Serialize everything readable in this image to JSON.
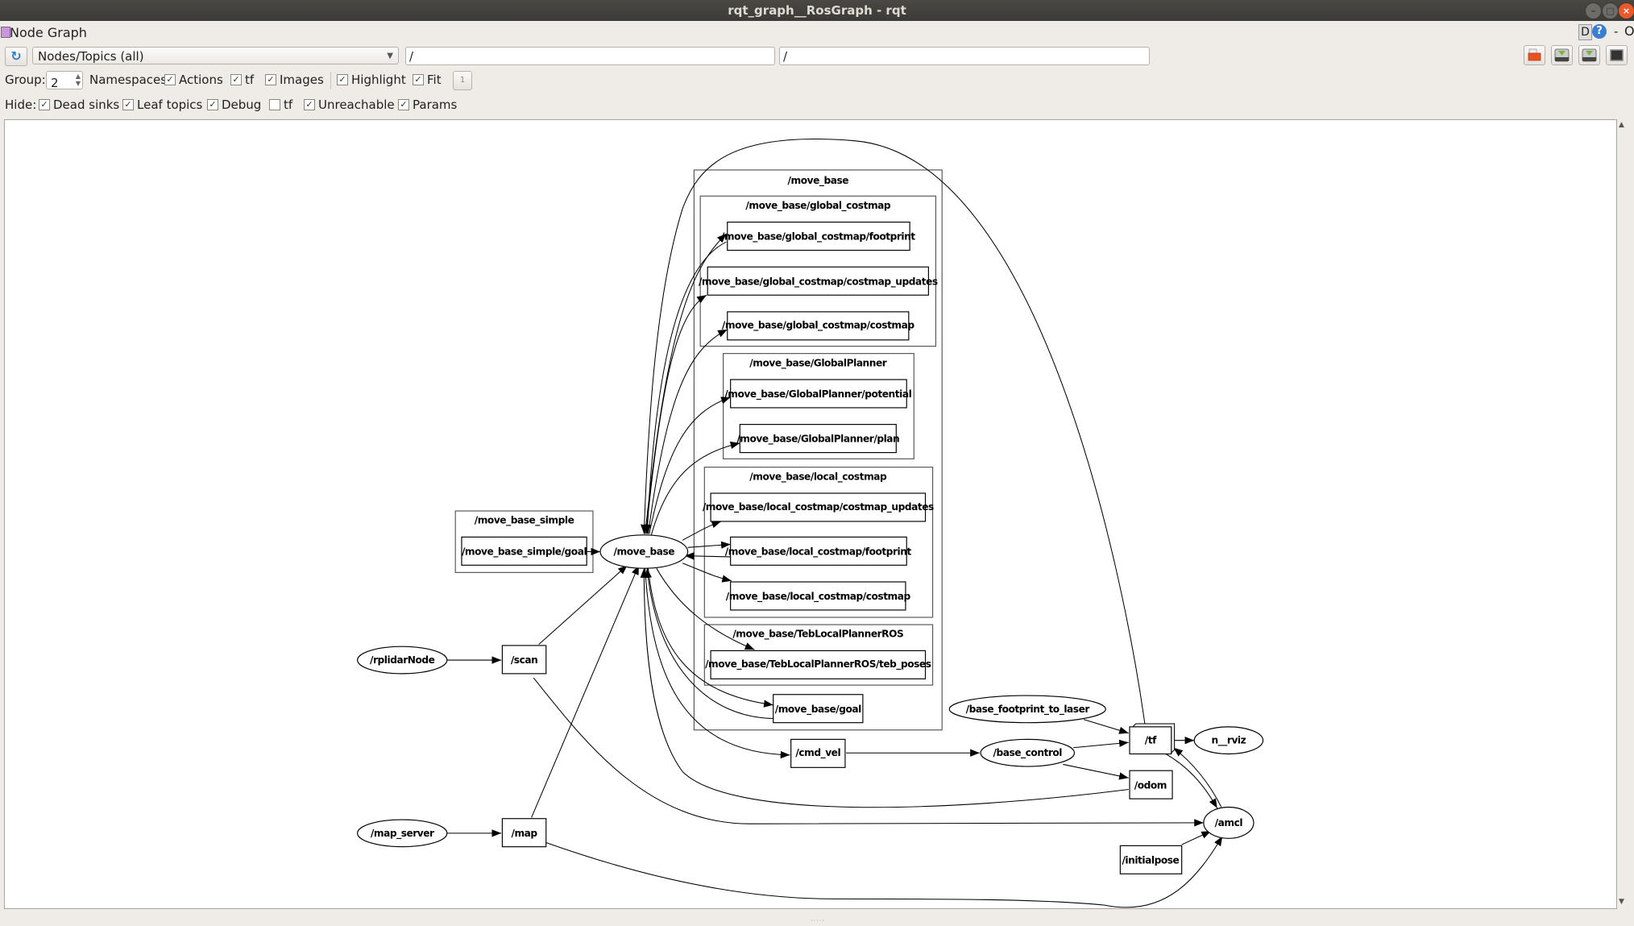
{
  "window": {
    "title": "rqt_graph__RosGraph - rqt",
    "controls": {
      "minimize": "–",
      "maximize": "□",
      "close": "×"
    }
  },
  "plugin": {
    "title": "Node Graph",
    "d_label": "D",
    "help_label": "?",
    "dash_label": "-",
    "close_label": "O"
  },
  "toolbar": {
    "refresh_icon": "refresh-icon",
    "graph_type": "Nodes/Topics (all)",
    "node_filter": "/",
    "topic_filter": "/",
    "buttons": [
      {
        "name": "load-dot-button",
        "icon": "folder-icon"
      },
      {
        "name": "save-dot-button",
        "icon": "save-icon"
      },
      {
        "name": "save-svg-button",
        "icon": "save-image-icon"
      },
      {
        "name": "save-image-button",
        "icon": "screen-icon"
      }
    ]
  },
  "options": {
    "group_label": "Group:",
    "group_value": "2",
    "namespaces_label": "Namespaces",
    "actions": {
      "label": "Actions",
      "checked": true
    },
    "tf": {
      "label": "tf",
      "checked": true
    },
    "images": {
      "label": "Images",
      "checked": true
    },
    "highlight": {
      "label": "Highlight",
      "checked": true
    },
    "fit": {
      "label": "Fit",
      "checked": true
    },
    "fit_button_label": "1"
  },
  "hide": {
    "label": "Hide:",
    "dead_sinks": {
      "label": "Dead sinks",
      "checked": true
    },
    "leaf_topics": {
      "label": "Leaf topics",
      "checked": true
    },
    "debug": {
      "label": "Debug",
      "checked": true
    },
    "tf": {
      "label": "tf",
      "checked": false
    },
    "unreachable": {
      "label": "Unreachable",
      "checked": true
    },
    "params": {
      "label": "Params",
      "checked": true
    }
  },
  "graph": {
    "clusters": {
      "move_base": "/move_base",
      "global_costmap": "/move_base/global_costmap",
      "global_planner": "/move_base/GlobalPlanner",
      "local_costmap": "/move_base/local_costmap",
      "teb": "/move_base/TebLocalPlannerROS",
      "move_base_simple": "/move_base_simple"
    },
    "topics": {
      "gc_footprint": "/move_base/global_costmap/footprint",
      "gc_updates": "/move_base/global_costmap/costmap_updates",
      "gc_costmap": "/move_base/global_costmap/costmap",
      "gp_potential": "/move_base/GlobalPlanner/potential",
      "gp_plan": "/move_base/GlobalPlanner/plan",
      "lc_updates": "/move_base/local_costmap/costmap_updates",
      "lc_footprint": "/move_base/local_costmap/footprint",
      "lc_costmap": "/move_base/local_costmap/costmap",
      "teb_poses": "/move_base/TebLocalPlannerROS/teb_poses",
      "mb_goal": "/move_base/goal",
      "mbs_goal": "/move_base_simple/goal",
      "scan": "/scan",
      "map": "/map",
      "cmd_vel": "/cmd_vel",
      "tf": "/tf",
      "odom": "/odom",
      "initialpose": "/initialpose"
    },
    "nodes": {
      "move_base": "/move_base",
      "rplidar": "/rplidarNode",
      "map_server": "/map_server",
      "base_control": "/base_control",
      "bf_to_laser": "/base_footprint_to_laser",
      "rviz": "n__rviz",
      "amcl": "/amcl"
    }
  }
}
